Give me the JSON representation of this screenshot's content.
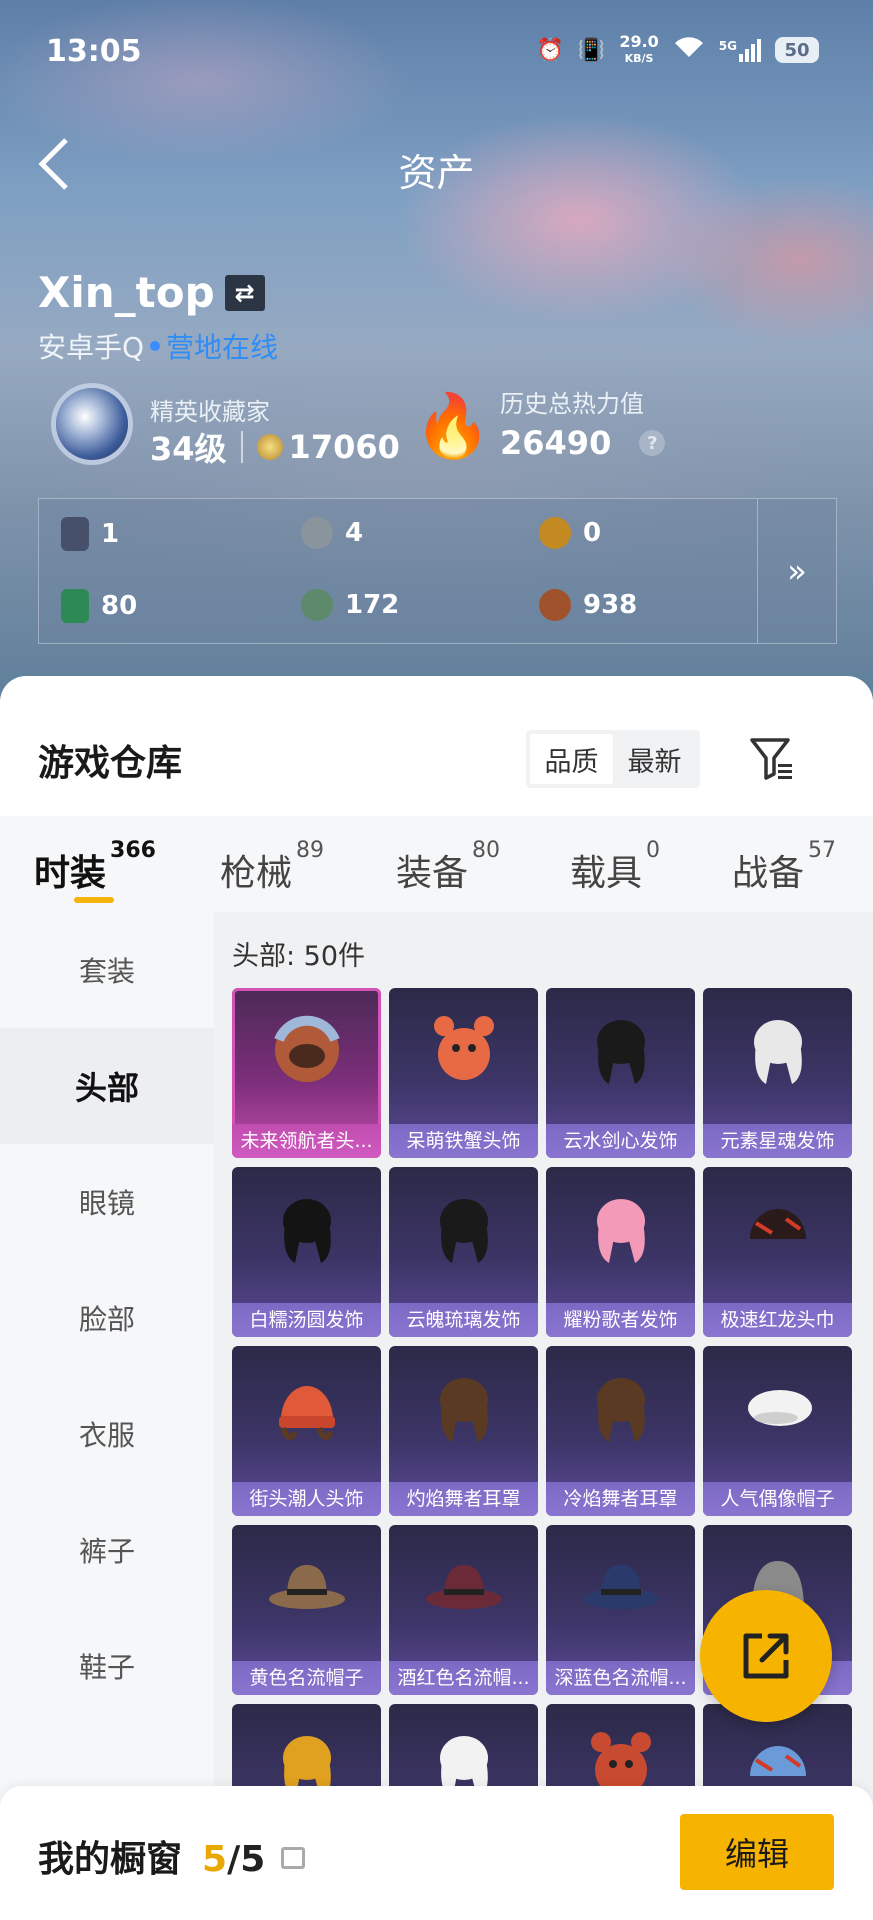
{
  "status_bar": {
    "time": "13:05",
    "net_speed": "29.0",
    "net_unit": "KB/S",
    "signal": "5G",
    "battery": "50"
  },
  "header": {
    "title": "资产"
  },
  "profile": {
    "username": "Xin_top",
    "platform": "安卓手Q",
    "status": "营地在线",
    "rank_label": "精英收藏家",
    "rank_level": "34级",
    "rank_points": "17060",
    "heat_label": "历史总热力值",
    "heat_value": "26490",
    "heat_help": "?"
  },
  "stats": [
    {
      "icon": "card-icon",
      "value": "1",
      "color": "#46506a"
    },
    {
      "icon": "silver-coin-icon",
      "value": "4",
      "color": "#8a949c"
    },
    {
      "icon": "gold-coin-icon",
      "value": "0",
      "color": "#c48a22"
    },
    {
      "icon": "green-card-icon",
      "value": "80",
      "color": "#2e8a55"
    },
    {
      "icon": "green-coin-icon",
      "value": "172",
      "color": "#5c8a6a"
    },
    {
      "icon": "bronze-coin-icon",
      "value": "938",
      "color": "#a0522d"
    }
  ],
  "stats_more": "»",
  "warehouse": {
    "title": "游戏仓库",
    "sort_options": [
      "品质",
      "最新"
    ],
    "sort_selected": "品质"
  },
  "tabs": [
    {
      "label": "时装",
      "count": "366"
    },
    {
      "label": "枪械",
      "count": "89"
    },
    {
      "label": "装备",
      "count": "80"
    },
    {
      "label": "载具",
      "count": "0"
    },
    {
      "label": "战备",
      "count": "57"
    }
  ],
  "categories": [
    "套装",
    "头部",
    "眼镜",
    "脸部",
    "衣服",
    "裤子",
    "鞋子"
  ],
  "selected_category": "头部",
  "item_count": "头部: 50件",
  "items": [
    {
      "name": "未来领航者头...",
      "art": "helmet",
      "color": "#b05a3a"
    },
    {
      "name": "呆萌铁蟹头饰",
      "art": "crab",
      "color": "#e86a45"
    },
    {
      "name": "云水剑心发饰",
      "art": "hair",
      "color": "#1a1a1a"
    },
    {
      "name": "元素星魂发饰",
      "art": "hair",
      "color": "#e8e8e8"
    },
    {
      "name": "白糯汤圆发饰",
      "art": "hair",
      "color": "#141414"
    },
    {
      "name": "云魄琉璃发饰",
      "art": "hair",
      "color": "#1a1a1a"
    },
    {
      "name": "耀粉歌者发饰",
      "art": "hair",
      "color": "#f29ab8"
    },
    {
      "name": "极速红龙头巾",
      "art": "cap",
      "color": "#2a1a1a"
    },
    {
      "name": "街头潮人头饰",
      "art": "beanie",
      "color": "#e05a3a"
    },
    {
      "name": "灼焰舞者耳罩",
      "art": "hair",
      "color": "#5a3a22"
    },
    {
      "name": "冷焰舞者耳罩",
      "art": "hair",
      "color": "#5a3a22"
    },
    {
      "name": "人气偶像帽子",
      "art": "beret",
      "color": "#f2f2f2"
    },
    {
      "name": "黄色名流帽子",
      "art": "fedora",
      "color": "#8a6a4a"
    },
    {
      "name": "酒红色名流帽...",
      "art": "fedora",
      "color": "#6a2a38"
    },
    {
      "name": "深蓝色名流帽...",
      "art": "fedora",
      "color": "#2a3a6a"
    },
    {
      "name": "套",
      "art": "hood",
      "color": "#8a8a8a"
    },
    {
      "name": "",
      "art": "hair",
      "color": "#e0a020"
    },
    {
      "name": "",
      "art": "hair",
      "color": "#f2f2f2"
    },
    {
      "name": "",
      "art": "crab",
      "color": "#c84a30"
    },
    {
      "name": "",
      "art": "cap",
      "color": "#6a9ad8"
    }
  ],
  "bottom_bar": {
    "label": "我的橱窗",
    "count_current": "5",
    "count_sep": "/",
    "count_total": "5",
    "edit_label": "编辑"
  },
  "accent": "#f6b400"
}
